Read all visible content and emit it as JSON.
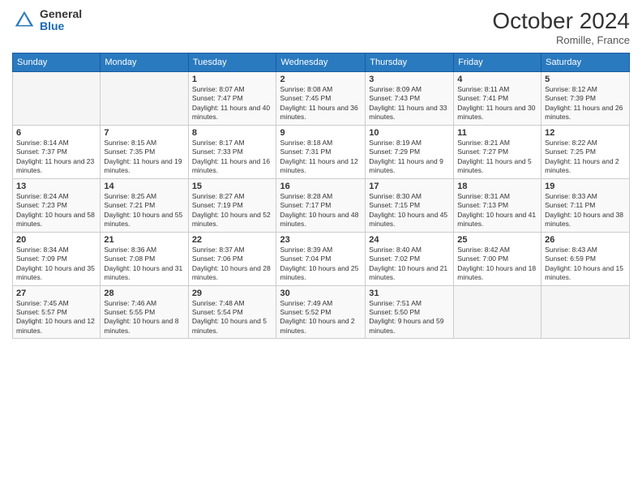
{
  "logo": {
    "general": "General",
    "blue": "Blue"
  },
  "header": {
    "month": "October 2024",
    "location": "Romille, France"
  },
  "weekdays": [
    "Sunday",
    "Monday",
    "Tuesday",
    "Wednesday",
    "Thursday",
    "Friday",
    "Saturday"
  ],
  "weeks": [
    [
      {
        "date": "",
        "info": ""
      },
      {
        "date": "",
        "info": ""
      },
      {
        "date": "1",
        "info": "Sunrise: 8:07 AM\nSunset: 7:47 PM\nDaylight: 11 hours and 40 minutes."
      },
      {
        "date": "2",
        "info": "Sunrise: 8:08 AM\nSunset: 7:45 PM\nDaylight: 11 hours and 36 minutes."
      },
      {
        "date": "3",
        "info": "Sunrise: 8:09 AM\nSunset: 7:43 PM\nDaylight: 11 hours and 33 minutes."
      },
      {
        "date": "4",
        "info": "Sunrise: 8:11 AM\nSunset: 7:41 PM\nDaylight: 11 hours and 30 minutes."
      },
      {
        "date": "5",
        "info": "Sunrise: 8:12 AM\nSunset: 7:39 PM\nDaylight: 11 hours and 26 minutes."
      }
    ],
    [
      {
        "date": "6",
        "info": "Sunrise: 8:14 AM\nSunset: 7:37 PM\nDaylight: 11 hours and 23 minutes."
      },
      {
        "date": "7",
        "info": "Sunrise: 8:15 AM\nSunset: 7:35 PM\nDaylight: 11 hours and 19 minutes."
      },
      {
        "date": "8",
        "info": "Sunrise: 8:17 AM\nSunset: 7:33 PM\nDaylight: 11 hours and 16 minutes."
      },
      {
        "date": "9",
        "info": "Sunrise: 8:18 AM\nSunset: 7:31 PM\nDaylight: 11 hours and 12 minutes."
      },
      {
        "date": "10",
        "info": "Sunrise: 8:19 AM\nSunset: 7:29 PM\nDaylight: 11 hours and 9 minutes."
      },
      {
        "date": "11",
        "info": "Sunrise: 8:21 AM\nSunset: 7:27 PM\nDaylight: 11 hours and 5 minutes."
      },
      {
        "date": "12",
        "info": "Sunrise: 8:22 AM\nSunset: 7:25 PM\nDaylight: 11 hours and 2 minutes."
      }
    ],
    [
      {
        "date": "13",
        "info": "Sunrise: 8:24 AM\nSunset: 7:23 PM\nDaylight: 10 hours and 58 minutes."
      },
      {
        "date": "14",
        "info": "Sunrise: 8:25 AM\nSunset: 7:21 PM\nDaylight: 10 hours and 55 minutes."
      },
      {
        "date": "15",
        "info": "Sunrise: 8:27 AM\nSunset: 7:19 PM\nDaylight: 10 hours and 52 minutes."
      },
      {
        "date": "16",
        "info": "Sunrise: 8:28 AM\nSunset: 7:17 PM\nDaylight: 10 hours and 48 minutes."
      },
      {
        "date": "17",
        "info": "Sunrise: 8:30 AM\nSunset: 7:15 PM\nDaylight: 10 hours and 45 minutes."
      },
      {
        "date": "18",
        "info": "Sunrise: 8:31 AM\nSunset: 7:13 PM\nDaylight: 10 hours and 41 minutes."
      },
      {
        "date": "19",
        "info": "Sunrise: 8:33 AM\nSunset: 7:11 PM\nDaylight: 10 hours and 38 minutes."
      }
    ],
    [
      {
        "date": "20",
        "info": "Sunrise: 8:34 AM\nSunset: 7:09 PM\nDaylight: 10 hours and 35 minutes."
      },
      {
        "date": "21",
        "info": "Sunrise: 8:36 AM\nSunset: 7:08 PM\nDaylight: 10 hours and 31 minutes."
      },
      {
        "date": "22",
        "info": "Sunrise: 8:37 AM\nSunset: 7:06 PM\nDaylight: 10 hours and 28 minutes."
      },
      {
        "date": "23",
        "info": "Sunrise: 8:39 AM\nSunset: 7:04 PM\nDaylight: 10 hours and 25 minutes."
      },
      {
        "date": "24",
        "info": "Sunrise: 8:40 AM\nSunset: 7:02 PM\nDaylight: 10 hours and 21 minutes."
      },
      {
        "date": "25",
        "info": "Sunrise: 8:42 AM\nSunset: 7:00 PM\nDaylight: 10 hours and 18 minutes."
      },
      {
        "date": "26",
        "info": "Sunrise: 8:43 AM\nSunset: 6:59 PM\nDaylight: 10 hours and 15 minutes."
      }
    ],
    [
      {
        "date": "27",
        "info": "Sunrise: 7:45 AM\nSunset: 5:57 PM\nDaylight: 10 hours and 12 minutes."
      },
      {
        "date": "28",
        "info": "Sunrise: 7:46 AM\nSunset: 5:55 PM\nDaylight: 10 hours and 8 minutes."
      },
      {
        "date": "29",
        "info": "Sunrise: 7:48 AM\nSunset: 5:54 PM\nDaylight: 10 hours and 5 minutes."
      },
      {
        "date": "30",
        "info": "Sunrise: 7:49 AM\nSunset: 5:52 PM\nDaylight: 10 hours and 2 minutes."
      },
      {
        "date": "31",
        "info": "Sunrise: 7:51 AM\nSunset: 5:50 PM\nDaylight: 9 hours and 59 minutes."
      },
      {
        "date": "",
        "info": ""
      },
      {
        "date": "",
        "info": ""
      }
    ]
  ]
}
